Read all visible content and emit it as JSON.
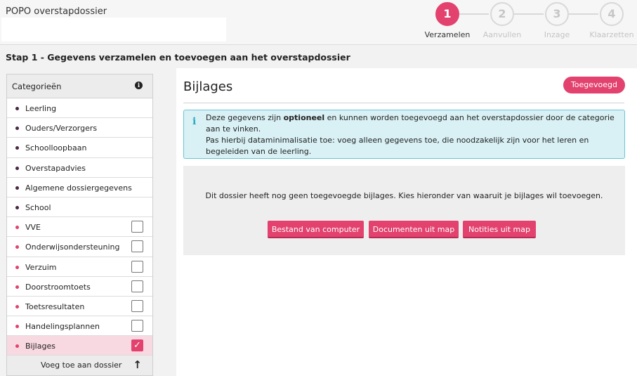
{
  "app": {
    "title": "POPO overstapdossier"
  },
  "steps": [
    {
      "number": "1",
      "label": "Verzamelen"
    },
    {
      "number": "2",
      "label": "Aanvullen"
    },
    {
      "number": "3",
      "label": "Inzage"
    },
    {
      "number": "4",
      "label": "Klaarzetten"
    }
  ],
  "page": {
    "heading": "Stap 1 - Gegevens verzamelen en toevoegen aan het overstapdossier"
  },
  "sidebar": {
    "header": "Categorieën",
    "items": [
      {
        "label": "Leerling"
      },
      {
        "label": "Ouders/Verzorgers"
      },
      {
        "label": "Schoolloopbaan"
      },
      {
        "label": "Overstapadvies"
      },
      {
        "label": "Algemene dossiergegevens"
      },
      {
        "label": "School"
      },
      {
        "label": "VVE",
        "checked": false
      },
      {
        "label": "Onderwijsondersteuning",
        "checked": false
      },
      {
        "label": "Verzuim",
        "checked": false
      },
      {
        "label": "Doorstroomtoets",
        "checked": false
      },
      {
        "label": "Toetsresultaten",
        "checked": false
      },
      {
        "label": "Handelingsplannen",
        "checked": false
      },
      {
        "label": "Bijlages",
        "checked": true
      }
    ],
    "footer": "Voeg toe aan dossier"
  },
  "panel": {
    "title": "Bijlages",
    "status_button": "Toegevoegd",
    "info_prefix": "Deze gegevens zijn ",
    "info_bold": "optioneel",
    "info_suffix": " en kunnen worden toegevoegd aan het overstapdossier door de categorie aan te vinken.",
    "info_line2": "Pas hierbij dataminimalisatie toe: voeg alleen gegevens toe, die noodzakelijk zijn voor het leren en begeleiden van de leerling.",
    "empty_message": "Dit dossier heeft nog geen toegevoegde bijlages. Kies hieronder van waaruit je bijlages wil toevoegen.",
    "buttons": {
      "computer": "Bestand van computer",
      "folder_docs": "Documenten uit map",
      "folder_notes": "Notities uit map"
    }
  },
  "colors": {
    "accent": "#e2426d",
    "info_bg": "#d9f1f5",
    "info_border": "#6ac6d3"
  }
}
